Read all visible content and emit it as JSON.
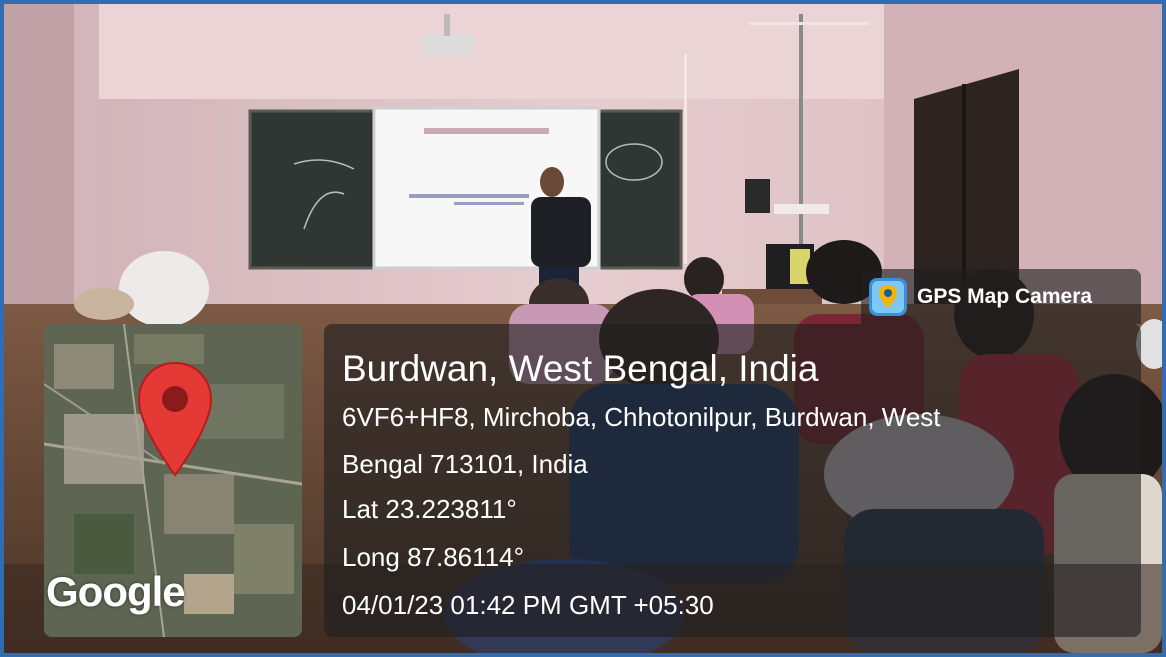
{
  "app_tag": {
    "label": "GPS Map Camera",
    "icon": "gps-map-camera-app-icon"
  },
  "location": {
    "title": "Burdwan, West Bengal, India",
    "address_line1": "6VF6+HF8, Mirchoba, Chhotonilpur, Burdwan, West",
    "address_line2": "Bengal 713101, India",
    "latitude": "Lat 23.223811°",
    "longitude": "Long 87.86114°",
    "datetime": "04/01/23 01:42 PM GMT +05:30"
  },
  "map": {
    "attribution": "Google",
    "marker_icon": "map-pin-icon"
  },
  "colors": {
    "frame_border": "#2f6db5",
    "wall": "#e4c9cc",
    "marker": "#e53935",
    "overlay": "#1e1e1e"
  }
}
